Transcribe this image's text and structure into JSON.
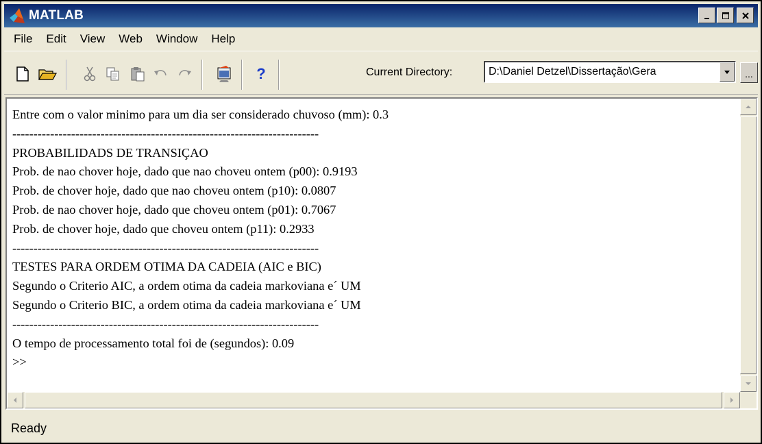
{
  "window": {
    "title": "MATLAB"
  },
  "window_controls": {
    "minimize": "_",
    "maximize": "□",
    "close": "×"
  },
  "menu": [
    "File",
    "Edit",
    "View",
    "Web",
    "Window",
    "Help"
  ],
  "toolbar": {
    "icons": [
      "new-file-icon",
      "open-folder-icon",
      "cut-icon",
      "copy-icon",
      "paste-icon",
      "undo-icon",
      "redo-icon",
      "simulink-icon",
      "help-icon"
    ],
    "help_label": "?",
    "current_directory_label": "Current Directory:",
    "current_directory_value": "D:\\Daniel Detzel\\Dissertação\\Gera",
    "browse_label": "..."
  },
  "command_window": {
    "lines": [
      "Entre com o valor minimo para um dia ser considerado chuvoso (mm): 0.3",
      "-------------------------------------------------------------------------",
      "PROBABILIDADS DE TRANSIÇAO",
      "Prob. de nao chover hoje, dado que nao choveu ontem (p00): 0.9193",
      "Prob. de chover hoje, dado que nao choveu ontem (p10): 0.0807",
      "Prob. de nao chover hoje, dado que choveu ontem (p01): 0.7067",
      "Prob. de chover hoje, dado que choveu ontem (p11): 0.2933",
      "-------------------------------------------------------------------------",
      "TESTES PARA ORDEM OTIMA DA CADEIA (AIC e BIC)",
      "Segundo o Criterio AIC, a ordem otima da cadeia markoviana e´ UM",
      "Segundo o Criterio BIC, a ordem otima da cadeia markoviana e´ UM",
      "-------------------------------------------------------------------------",
      "O tempo de processamento total foi de (segundos): 0.09",
      ">>"
    ]
  },
  "status": {
    "text": "Ready"
  }
}
